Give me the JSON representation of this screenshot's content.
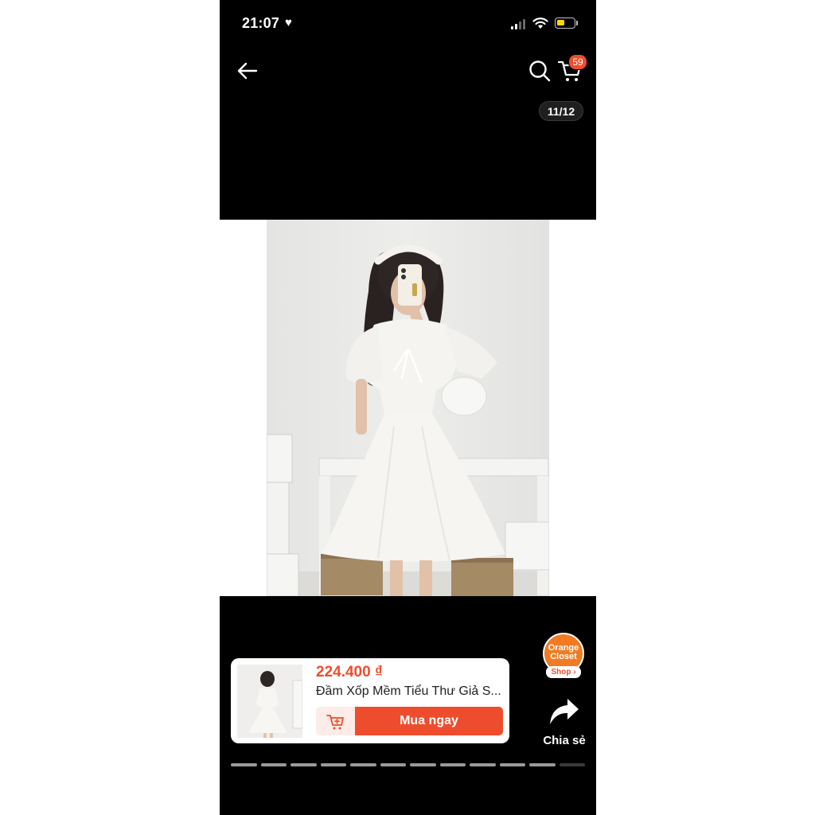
{
  "status_bar": {
    "time": "21:07"
  },
  "header": {
    "cart_count": "59",
    "image_counter": "11/12"
  },
  "product": {
    "price": "224.400 ₫",
    "title": "Đầm Xốp Mềm Tiểu Thư Giả S...",
    "buy_label": "Mua ngay"
  },
  "shop": {
    "line1": "Orange",
    "line2": "Closet",
    "tag": "Shop ›"
  },
  "share": {
    "label": "Chia sẻ"
  },
  "pager": {
    "total": 12,
    "current": 11
  },
  "colors": {
    "accent": "#ee4d2d",
    "shop_orange": "#f07b22"
  },
  "icons": [
    "back-arrow-icon",
    "search-icon",
    "cart-icon",
    "heart-icon",
    "add-to-cart-icon",
    "share-arrow-icon"
  ]
}
